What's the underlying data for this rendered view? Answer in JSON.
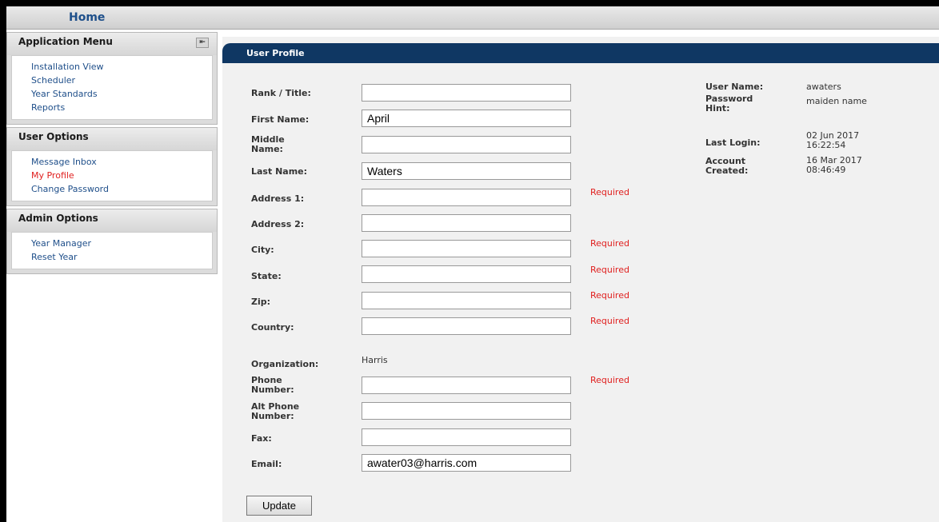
{
  "header": {
    "home_label": "Home"
  },
  "sidebar": {
    "application_menu": {
      "title": "Application Menu",
      "collapse_icon": "collapse-left-icon",
      "items": [
        "Installation View",
        "Scheduler",
        "Year Standards",
        "Reports"
      ]
    },
    "user_options": {
      "title": "User Options",
      "items": [
        "Message Inbox",
        "My Profile",
        "Change Password"
      ],
      "active": "My Profile"
    },
    "admin_options": {
      "title": "Admin Options",
      "items": [
        "Year Manager",
        "Reset Year"
      ]
    }
  },
  "main": {
    "title": "User Profile",
    "fields": {
      "rank": {
        "label": "Rank / Title:",
        "value": ""
      },
      "first_name": {
        "label": "First Name:",
        "value": "April"
      },
      "middle_name": {
        "label": "Middle Name:",
        "value": ""
      },
      "last_name": {
        "label": "Last Name:",
        "value": "Waters"
      },
      "address1": {
        "label": "Address 1:",
        "value": "",
        "note": "Required"
      },
      "address2": {
        "label": "Address 2:",
        "value": ""
      },
      "city": {
        "label": "City:",
        "value": "",
        "note": "Required"
      },
      "state": {
        "label": "State:",
        "value": "",
        "note": "Required"
      },
      "zip": {
        "label": "Zip:",
        "value": "",
        "note": "Required"
      },
      "country": {
        "label": "Country:",
        "value": "",
        "note": "Required"
      },
      "organization": {
        "label": "Organization:",
        "value": "Harris"
      },
      "phone": {
        "label": "Phone Number:",
        "value": "",
        "note": "Required"
      },
      "alt_phone": {
        "label": "Alt Phone Number:",
        "value": ""
      },
      "fax": {
        "label": "Fax:",
        "value": ""
      },
      "email": {
        "label": "Email:",
        "value": "awater03@harris.com"
      }
    },
    "update_label": "Update",
    "info": {
      "user_name_label": "User Name:",
      "user_name": "awaters",
      "password_hint_label": "Password Hint:",
      "password_hint": "maiden name",
      "last_login_label": "Last Login:",
      "last_login_date": "02 Jun 2017",
      "last_login_time": "16:22:54",
      "account_created_label": "Account Created:",
      "account_created_date": "16 Mar 2017",
      "account_created_time": "08:46:49"
    }
  },
  "colors": {
    "header_bar": "#0f3763",
    "link": "#1f4f8a",
    "active_link": "#e0201f",
    "required": "#e0201f"
  }
}
